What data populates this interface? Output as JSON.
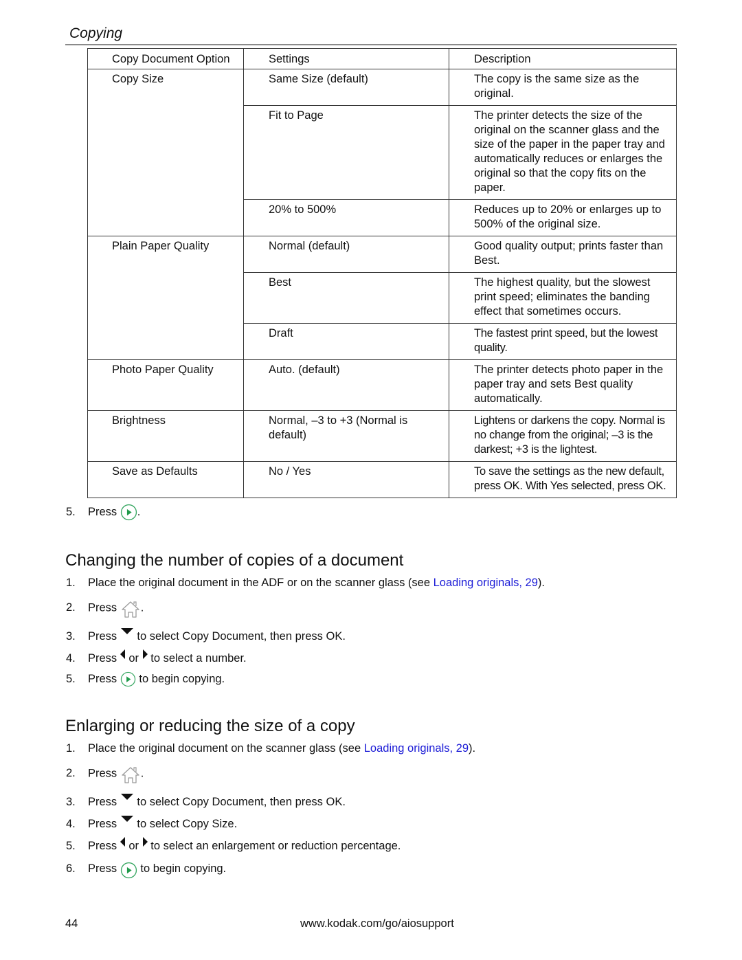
{
  "header": {
    "section": "Copying"
  },
  "table": {
    "columns": [
      "Copy Document Option",
      "Settings",
      "Description"
    ],
    "rows": [
      {
        "option": "Copy Size",
        "settings": [
          {
            "setting": "Same Size (default)",
            "description": "The copy is the same size as the original."
          },
          {
            "setting": "Fit to Page",
            "description": "The printer detects the size of the original on the scanner glass and the size of the paper in the paper tray and automatically reduces or enlarges the original so that the copy fits on the paper."
          },
          {
            "setting": "20% to 500%",
            "description": "Reduces up to 20% or enlarges up to 500% of the original size."
          }
        ]
      },
      {
        "option": "Plain Paper Quality",
        "settings": [
          {
            "setting": "Normal (default)",
            "description": "Good quality output; prints faster than Best."
          },
          {
            "setting": "Best",
            "description": "The highest quality, but the slowest print speed; eliminates the banding effect that sometimes occurs."
          },
          {
            "setting": "Draft",
            "description": "The fastest print speed, but the lowest quality."
          }
        ]
      },
      {
        "option": "Photo Paper Quality",
        "settings": [
          {
            "setting": "Auto. (default)",
            "description": "The printer detects photo paper in the paper tray and sets Best quality automatically."
          }
        ]
      },
      {
        "option": "Brightness",
        "settings": [
          {
            "setting": "Normal, –3 to +3 (Normal is default)",
            "description": "Lightens or darkens the copy. Normal is no change from the original; –3 is the darkest; +3 is the lightest."
          }
        ]
      },
      {
        "option": "Save as Defaults",
        "settings": [
          {
            "setting": "No / Yes",
            "description_parts": [
              "To save the settings as the new default, press ",
              "OK",
              ". With ",
              "Yes",
              " selected, press ",
              "OK",
              "."
            ]
          }
        ]
      }
    ]
  },
  "step_after_table": {
    "num": "5.",
    "press": "Press",
    "icon": "start-button-icon",
    "end": "."
  },
  "section1": {
    "title": "Changing the number of copies of a document",
    "steps": [
      {
        "num": "1.",
        "text": "Place the original document in the ADF or on the scanner glass (see ",
        "link": "Loading originals, 29",
        "end": ")."
      },
      {
        "num": "2.",
        "press": "Press",
        "icon": "home-icon",
        "end": "."
      },
      {
        "num": "3.",
        "press": "Press",
        "icon": "down-arrow-icon",
        "pre": " to select ",
        "bold1": "Copy Document",
        "mid": ", then press ",
        "bold2": "OK",
        "end": "."
      },
      {
        "num": "4.",
        "press": "Press",
        "icon": "left-arrow-icon",
        "or": "or",
        "icon2": "right-arrow-icon",
        "end": "to select a number."
      },
      {
        "num": "5.",
        "press": "Press",
        "icon": "start-button-icon",
        "end": "to begin copying."
      }
    ]
  },
  "section2": {
    "title": "Enlarging or reducing the size of a copy",
    "steps": [
      {
        "num": "1.",
        "text": "Place the original document on the scanner glass (see ",
        "link": "Loading originals, 29",
        "end": ")."
      },
      {
        "num": "2.",
        "press": "Press",
        "icon": "home-icon",
        "end": "."
      },
      {
        "num": "3.",
        "press": "Press",
        "icon": "down-arrow-icon",
        "pre": " to select ",
        "bold1": "Copy Document",
        "mid": ", then press ",
        "bold2": "OK",
        "end": "."
      },
      {
        "num": "4.",
        "press": "Press",
        "icon": "down-arrow-icon",
        "pre": " to select ",
        "bold1": "Copy Size",
        "end": "."
      },
      {
        "num": "5.",
        "press": "Press",
        "icon": "left-arrow-icon",
        "or": "or",
        "icon2": "right-arrow-icon",
        "end": "to select an enlargement or reduction percentage."
      },
      {
        "num": "6.",
        "press": "Press",
        "icon": "start-button-icon",
        "end": "to begin copying."
      }
    ]
  },
  "footer": {
    "page": "44",
    "url": "www.kodak.com/go/aiosupport"
  },
  "colors": {
    "link": "#1a1ad6",
    "start_green": "#1f9a4a",
    "icon_gray": "#9a9a9a"
  }
}
